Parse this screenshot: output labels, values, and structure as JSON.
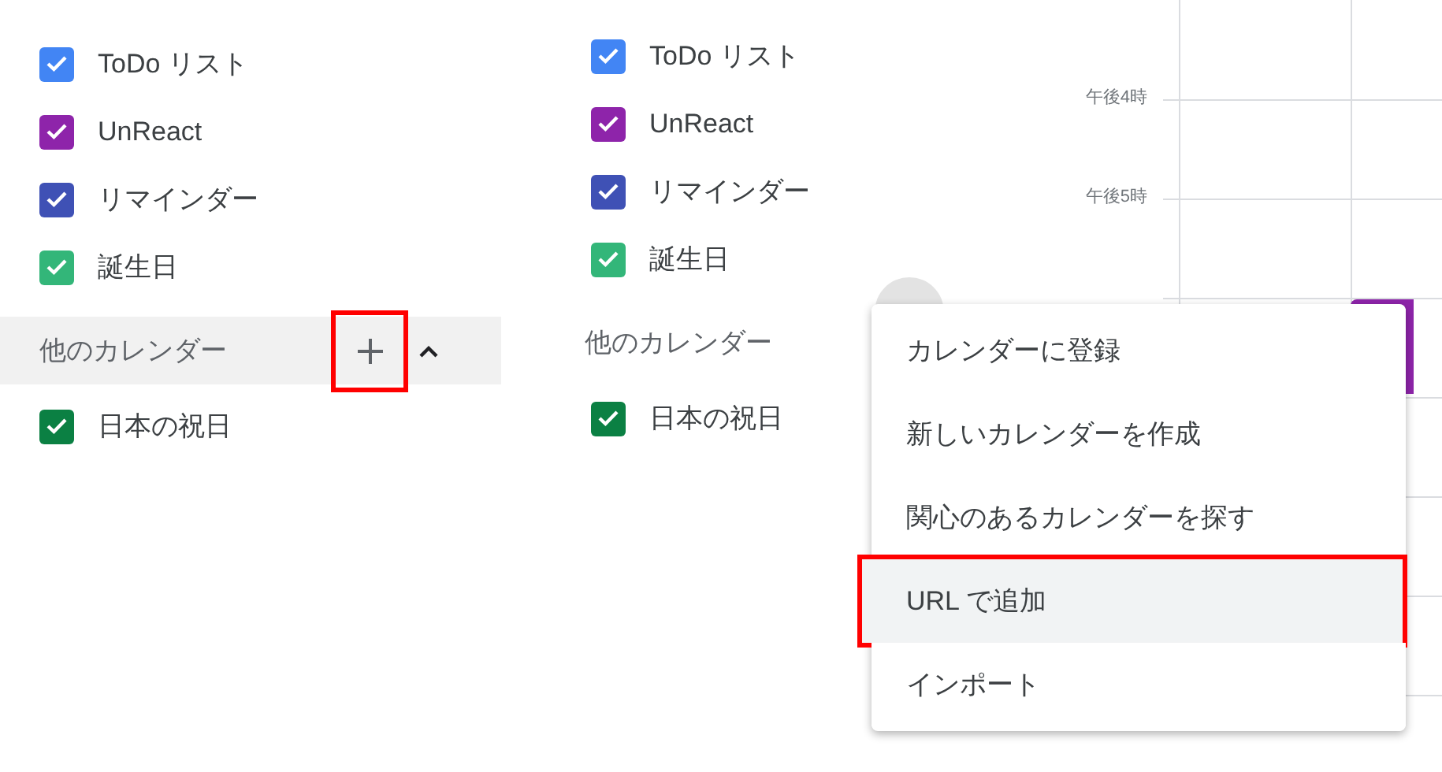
{
  "left_panel": {
    "calendars": [
      {
        "label": "ToDo リスト",
        "checked": true,
        "color": "#4285f4"
      },
      {
        "label": "UnReact",
        "checked": true,
        "color": "#8e24aa"
      },
      {
        "label": "リマインダー",
        "checked": true,
        "color": "#3f51b5"
      },
      {
        "label": "誕生日",
        "checked": true,
        "color": "#33b679"
      }
    ],
    "other_header": {
      "label": "他のカレンダー",
      "add_icon_highlighted": true,
      "expanded": true
    },
    "other_calendars": [
      {
        "label": "日本の祝日",
        "checked": true,
        "color": "#0b8043"
      }
    ]
  },
  "right_panel": {
    "calendars": [
      {
        "label": "ToDo リスト",
        "checked": true,
        "color": "#4285f4"
      },
      {
        "label": "UnReact",
        "checked": true,
        "color": "#8e24aa"
      },
      {
        "label": "リマインダー",
        "checked": true,
        "color": "#3f51b5"
      },
      {
        "label": "誕生日",
        "checked": true,
        "color": "#33b679"
      }
    ],
    "other_header": {
      "label": "他のカレンダー"
    },
    "other_calendars": [
      {
        "label": "日本の祝日",
        "checked": true,
        "color": "#0b8043"
      }
    ],
    "time_labels": [
      "午後4時",
      "午後5時"
    ],
    "menu": [
      {
        "label": "カレンダーに登録",
        "highlighted": false
      },
      {
        "label": "新しいカレンダーを作成",
        "highlighted": false
      },
      {
        "label": "関心のあるカレンダーを探す",
        "highlighted": false
      },
      {
        "label": "URL で追加",
        "highlighted": true
      },
      {
        "label": "インポート",
        "highlighted": false
      }
    ]
  }
}
